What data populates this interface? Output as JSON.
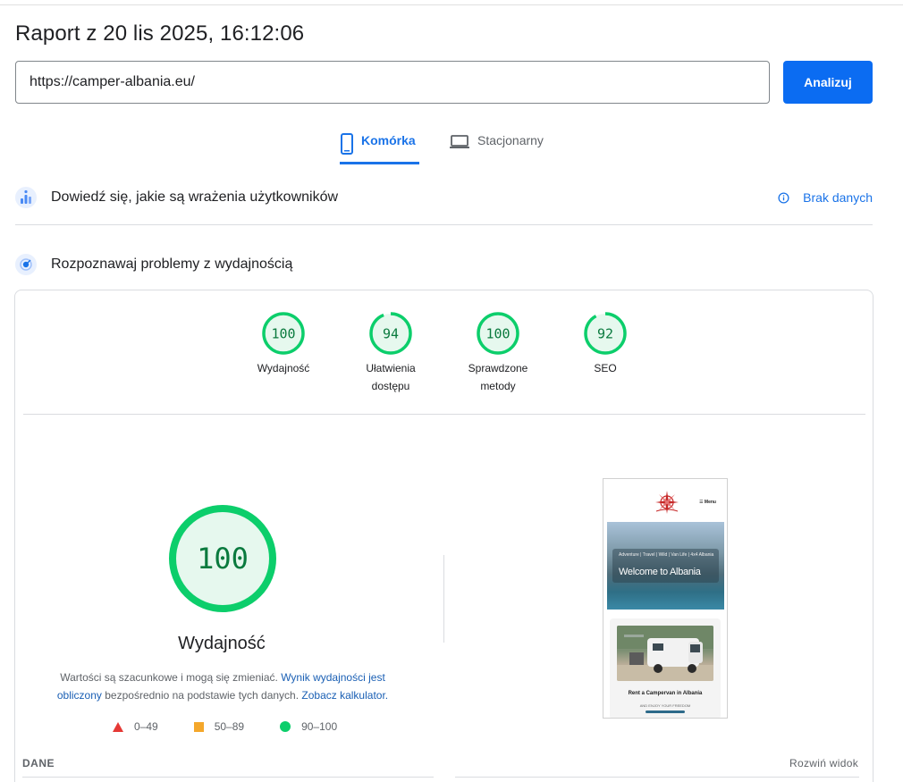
{
  "report": {
    "title": "Raport z 20 lis 2025, 16:12:06"
  },
  "search": {
    "url": "https://camper-albania.eu/",
    "analyze_label": "Analizuj"
  },
  "device_tabs": [
    {
      "label": "Komórka",
      "active": true,
      "icon": "smartphone-icon"
    },
    {
      "label": "Stacjonarny",
      "active": false,
      "icon": "laptop-icon"
    }
  ],
  "sections": {
    "field_data": {
      "title": "Dowiedź się, jakie są wrażenia użytkowników",
      "status_label": "Brak danych",
      "icon": "user-experience-icon"
    },
    "lab_data": {
      "title": "Rozpoznawaj problemy z wydajnością",
      "icon": "lighthouse-icon"
    }
  },
  "scores": [
    {
      "value": "100",
      "score": 100,
      "label": "Wydajność",
      "label_line2": ""
    },
    {
      "value": "94",
      "score": 94,
      "label": "Ułatwienia",
      "label_line2": "dostępu"
    },
    {
      "value": "100",
      "score": 100,
      "label": "Sprawdzone",
      "label_line2": "metody"
    },
    {
      "value": "92",
      "score": 92,
      "label": "SEO",
      "label_line2": ""
    }
  ],
  "performance": {
    "score": "100",
    "title": "Wydajność",
    "desc_part1": "Wartości są szacunkowe i mogą się zmieniać.",
    "desc_link1": "Wynik wydajności jest obliczony",
    "desc_part2": "bezpośrednio na podstawie tych danych.",
    "desc_link2": "Zobacz kalkulator."
  },
  "legend": [
    {
      "range": "0–49",
      "shape": "triangle",
      "color": "#e53935"
    },
    {
      "range": "50–89",
      "shape": "square",
      "color": "#f4a72b"
    },
    {
      "range": "90–100",
      "shape": "circle",
      "color": "#0cce6b"
    }
  ],
  "screenshot": {
    "menu_label": "☰ Menu",
    "hero_small": "Adventure | Travel | Wild | Van Life | 4x4 Albania",
    "hero_big": "Welcome to Albania",
    "card_title": "Rent a Campervan in Albania",
    "card_sub": "AND ENJOY YOUR FREEDOM"
  },
  "footer": {
    "left_label": "DANE",
    "right_label": "Rozwiń widok"
  },
  "colors": {
    "accent": "#1a73e8",
    "button": "#0b6cf2",
    "pass_green": "#0cce6b",
    "pass_green_text": "#0a7a3e",
    "pass_green_bg": "#e6f8ee"
  }
}
